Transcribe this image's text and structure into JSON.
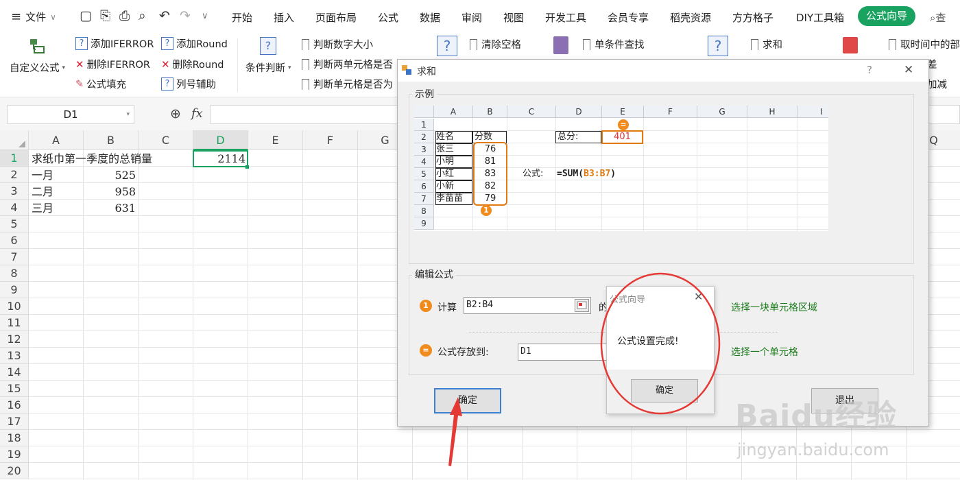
{
  "menu": {
    "file": "文件",
    "tabs": [
      "开始",
      "插入",
      "页面布局",
      "公式",
      "数据",
      "审阅",
      "视图",
      "开发工具",
      "会员专享",
      "稻壳资源",
      "方方格子",
      "DIY工具箱"
    ],
    "active_tab": "公式向导",
    "search_label": "查"
  },
  "ribbon": {
    "custom_formula": "自定义公式",
    "add_iferror": "添加IFERROR",
    "delete_iferror": "删除IFERROR",
    "formula_fill": "公式填充",
    "add_round": "添加Round",
    "delete_round": "删除Round",
    "column_helper": "列号辅助",
    "condition_judge": "条件判断",
    "judge_size": "判断数字大小",
    "judge_two_cells": "判断两单元格是否",
    "judge_cell": "判断单元格是否为",
    "clear_space": "清除空格",
    "single_lookup": "单条件查找",
    "sum": "求和",
    "extract_time": "取时间中的部",
    "partial_diff": "差",
    "partial_plusminus": "加减"
  },
  "formula_bar": {
    "name_box": "D1",
    "fx": "fx",
    "value": ""
  },
  "sheet": {
    "columns": [
      "A",
      "B",
      "C",
      "D",
      "E",
      "F",
      "G",
      "",
      "",
      "",
      "",
      "",
      "",
      "",
      "",
      "",
      "Q"
    ],
    "rows": [
      "1",
      "2",
      "3",
      "4",
      "5",
      "6",
      "7",
      "8",
      "9",
      "10",
      "11",
      "12",
      "13",
      "14",
      "15",
      "16",
      "17",
      "18",
      "19",
      "20"
    ],
    "cells": {
      "A1": "求纸巾第一季度的总销量",
      "D1": "2114",
      "A2": "一月",
      "B2": "525",
      "A3": "二月",
      "B3": "958",
      "A4": "三月",
      "B4": "631"
    }
  },
  "dialog": {
    "title": "求和",
    "help": "?",
    "close": "✕",
    "example_label": "示例",
    "mini_sheet": {
      "columns": [
        "A",
        "B",
        "C",
        "D",
        "E",
        "F",
        "G",
        "H",
        "I"
      ],
      "rows": [
        "1",
        "2",
        "3",
        "4",
        "5",
        "6",
        "7",
        "8",
        "9"
      ],
      "header_name": "姓名",
      "header_score": "分数",
      "names": [
        "张三",
        "小明",
        "小红",
        "小新",
        "李苗苗"
      ],
      "scores": [
        "76",
        "81",
        "83",
        "82",
        "79"
      ],
      "total_label": "总分:",
      "total_value": "401",
      "formula_label": "公式:",
      "formula_prefix": "=SUM(",
      "formula_range": "B3:B7",
      "formula_suffix": ")",
      "badge1": "1",
      "badge2": "="
    },
    "edit_label": "编辑公式",
    "calc_badge": "1",
    "calc_label": "计算",
    "calc_range": "B2:B4",
    "calc_suffix": "的",
    "calc_hint": "选择一块单元格区域",
    "store_badge": "=",
    "store_label": "公式存放到:",
    "store_cell": "D1",
    "store_hint": "选择一个单元格",
    "ok": "确定",
    "exit": "退出"
  },
  "popup": {
    "title": "公式向导",
    "close": "✕",
    "message": "公式设置完成!",
    "ok": "确定"
  },
  "watermark": {
    "brand": "Baidu经验",
    "url": "jingyan.baidu.com"
  },
  "colors": {
    "accent_green": "#1aa260",
    "orange": "#e07b12",
    "highlight_red": "#e53935",
    "dialog_button_border": "#3c7fd0"
  }
}
